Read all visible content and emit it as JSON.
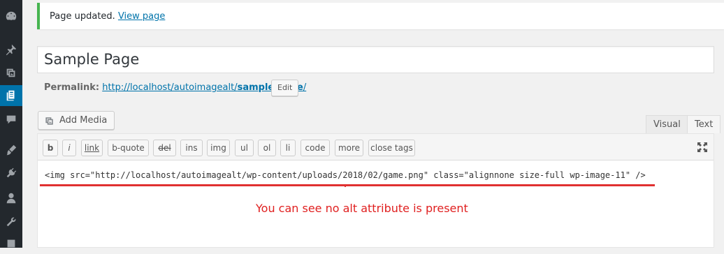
{
  "sidebar": {
    "icons": [
      "dashboard-icon",
      "pin-icon",
      "media-icon",
      "pages-icon",
      "comments-icon",
      "appearance-icon",
      "plugins-icon",
      "users-icon",
      "tools-icon",
      "settings-icon"
    ]
  },
  "notice": {
    "text": "Page updated.",
    "link": "View page"
  },
  "editor_title": "Sample Page",
  "permalink": {
    "label": "Permalink:",
    "url_base": "http://localhost/autoimagealt/",
    "slug": "sample-page",
    "url_end": "/",
    "edit_label": "Edit"
  },
  "add_media_label": "Add Media",
  "tabs": {
    "visual": "Visual",
    "text": "Text"
  },
  "quicktags": [
    "b",
    "i",
    "link",
    "b-quote",
    "del",
    "ins",
    "img",
    "ul",
    "ol",
    "li",
    "code",
    "more",
    "close tags"
  ],
  "code": "<img src=\"http://localhost/autoimagealt/wp-content/uploads/2018/02/game.png\" class=\"alignnone size-full wp-image-11\" />",
  "annotation": "You can see no alt attribute is present",
  "colors": {
    "accent": "#0073aa",
    "notice_border": "#46b450",
    "annotation": "#e02020"
  }
}
